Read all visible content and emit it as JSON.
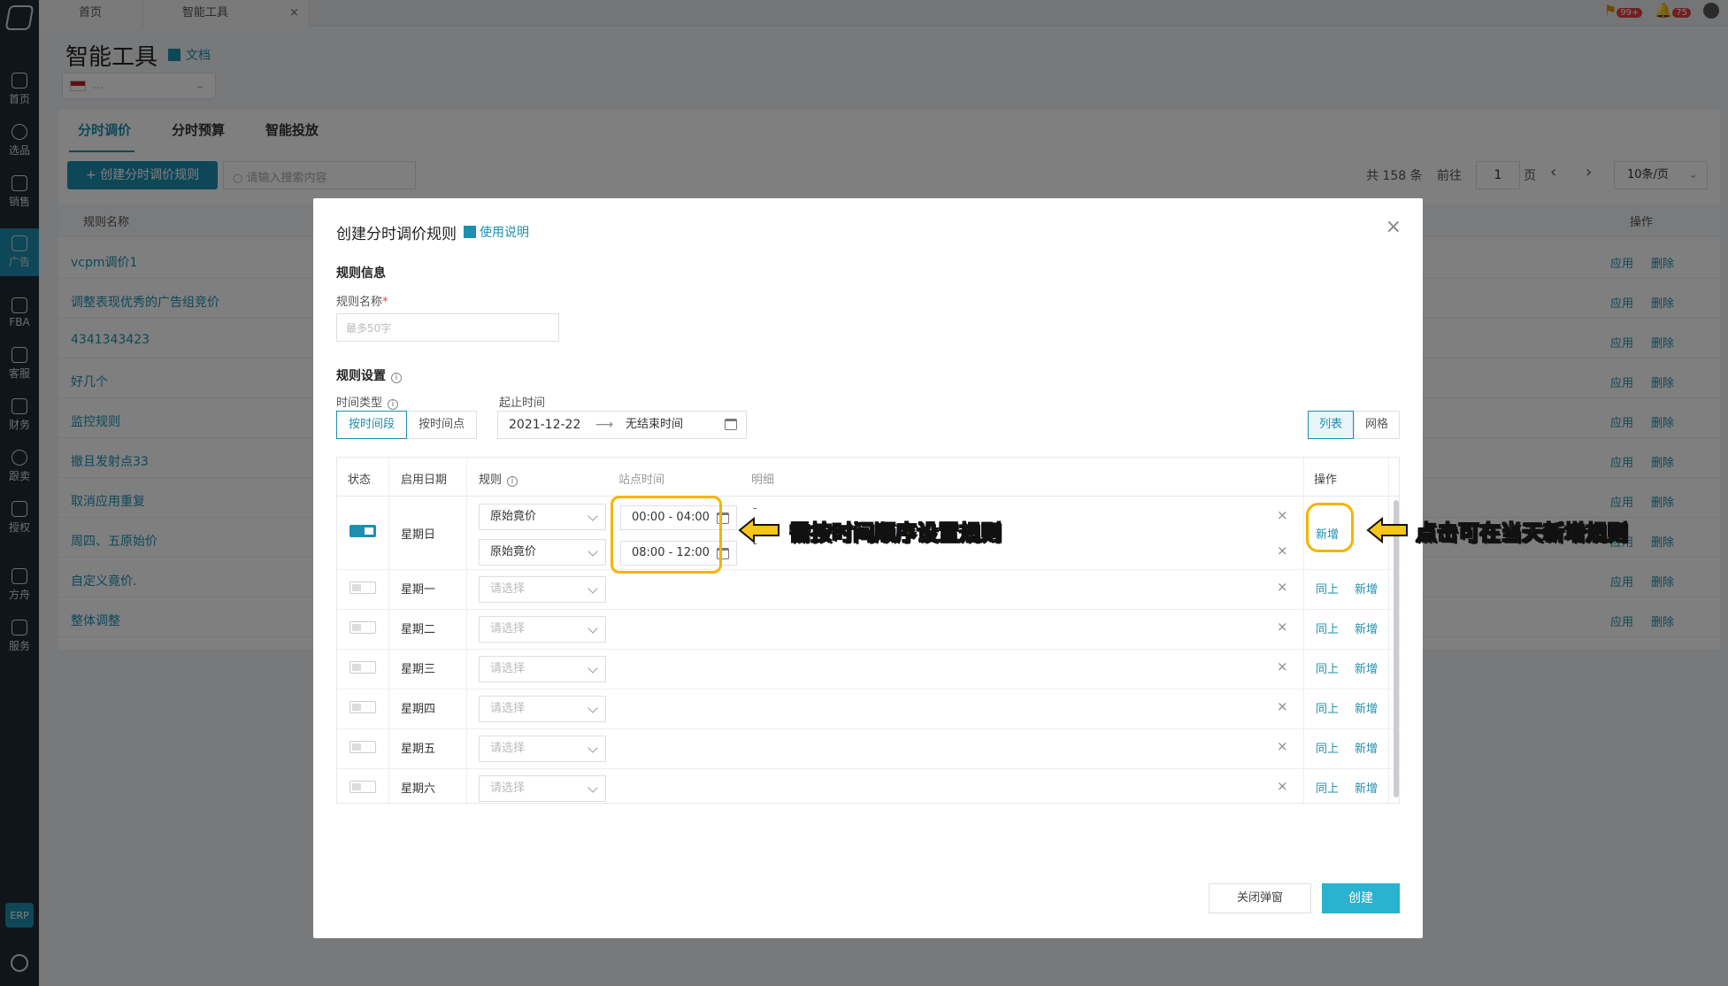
{
  "topbar": {
    "tabs": [
      {
        "label": "首页"
      },
      {
        "label": "智能工具"
      }
    ],
    "tab_close": "×",
    "notif_badge": "99+",
    "bell_badge": "75"
  },
  "sidebar": {
    "items": [
      {
        "label": "首页",
        "icon": "home-icon"
      },
      {
        "label": "选品",
        "icon": "search-icon"
      },
      {
        "label": "销售",
        "icon": "chart-icon"
      },
      {
        "label": "广告",
        "icon": "ad-icon",
        "active": true
      },
      {
        "label": "FBA",
        "icon": "warehouse-icon"
      },
      {
        "label": "客服",
        "icon": "support-icon"
      },
      {
        "label": "财务",
        "icon": "dollar-icon"
      },
      {
        "label": "跟卖",
        "icon": "pie-icon"
      },
      {
        "label": "授权",
        "icon": "shield-icon"
      },
      {
        "label": "方舟",
        "icon": "ark-icon"
      },
      {
        "label": "服务",
        "icon": "building-icon"
      }
    ],
    "erp": "ERP"
  },
  "page": {
    "title": "智能工具",
    "doc_link": "文档",
    "store_value": "..."
  },
  "main": {
    "tabs": [
      {
        "label": "分时调价"
      },
      {
        "label": "分时预算"
      },
      {
        "label": "智能投放"
      }
    ],
    "create_button": "+ 创建分时调价规则",
    "search_placeholder": "请输入搜索内容",
    "total": "共 158 条",
    "goto_label": "前往",
    "page_value": "1",
    "page_unit": "页",
    "prev": "‹",
    "next": "›",
    "page_size": "10条/页",
    "columns": {
      "name": "规则名称",
      "ops": "操作"
    },
    "rows": [
      {
        "name": "vcpm调价1"
      },
      {
        "name": "调整表现优秀的广告组竞价"
      },
      {
        "name": "4341343423"
      },
      {
        "name": "好几个"
      },
      {
        "name": "监控规则"
      },
      {
        "name": "撤且发射点33"
      },
      {
        "name": "取消应用重复"
      },
      {
        "name": "周四、五原始价"
      },
      {
        "name": "自定义竟价."
      },
      {
        "name": "整体调整"
      }
    ],
    "apply_label": "应用",
    "delete_label": "删除"
  },
  "modal": {
    "title": "创建分时调价规则",
    "help_link": "使用说明",
    "close": "×",
    "section_info": "规则信息",
    "name_label": "规则名称",
    "required_mark": "*",
    "name_placeholder": "最多50字",
    "section_settings": "规则设置",
    "time_type_label": "时间类型",
    "time_type_options": [
      "按时间段",
      "按时间点"
    ],
    "range_label": "起止时间",
    "start_date": "2021-12-22",
    "range_arrow": "⟶",
    "end_date": "无结束时间",
    "view_options": [
      "列表",
      "网格"
    ],
    "schedule_headers": {
      "status": "状态",
      "day": "启用日期",
      "rule": "规则",
      "site_time": "站点时间",
      "detail": "明细",
      "ops": "操作"
    },
    "select_placeholder": "请选择",
    "rule_value": "原始竟价",
    "time_slots": [
      "00:00 - 04:00",
      "08:00 - 12:00"
    ],
    "dash": "-",
    "row_delete": "×",
    "same_as_above": "同上",
    "add_label": "新增",
    "days": [
      {
        "label": "星期日",
        "enabled": true
      },
      {
        "label": "星期一",
        "enabled": false
      },
      {
        "label": "星期二",
        "enabled": false
      },
      {
        "label": "星期三",
        "enabled": false
      },
      {
        "label": "星期四",
        "enabled": false
      },
      {
        "label": "星期五",
        "enabled": false
      },
      {
        "label": "星期六",
        "enabled": false
      }
    ],
    "close_button": "关闭弹窗",
    "create_button": "创建"
  },
  "annotations": {
    "callout_1": "需按时间顺序设置规则",
    "callout_2": "点击可在当天新增规则",
    "highlight_color": "#f5b400"
  },
  "colors": {
    "accent": "#1d8fb0",
    "primary_button": "#28b3cf",
    "sidebar_bg": "#1f2a33"
  }
}
